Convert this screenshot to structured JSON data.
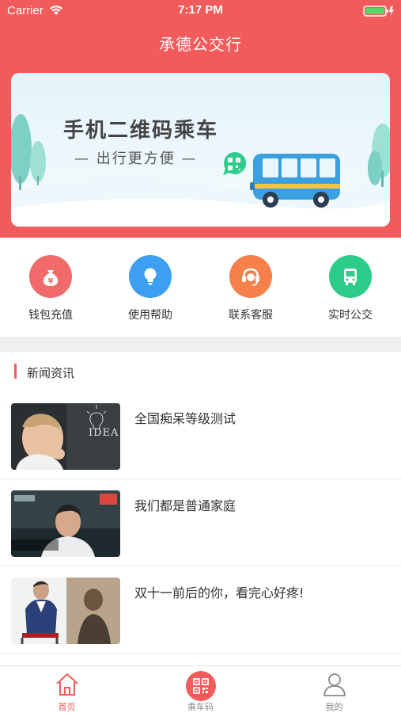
{
  "status_bar": {
    "carrier": "Carrier",
    "time": "7:17 PM"
  },
  "nav": {
    "title": "承德公交行"
  },
  "banner": {
    "title": "手机二维码乘车",
    "subtitle": "— 出行更方便 —"
  },
  "quick_menu": [
    {
      "label": "钱包充值",
      "icon": "money-bag-icon",
      "color": "#f06a6a"
    },
    {
      "label": "使用帮助",
      "icon": "lightbulb-icon",
      "color": "#3d9ff0"
    },
    {
      "label": "联系客服",
      "icon": "headset-icon",
      "color": "#f5804a"
    },
    {
      "label": "实时公交",
      "icon": "bus-icon",
      "color": "#2ecc8a"
    }
  ],
  "news": {
    "section_title": "新闻资讯",
    "items": [
      {
        "title": "全国痴呆等级测试",
        "thumb_text": "IDEA"
      },
      {
        "title": "我们都是普通家庭"
      },
      {
        "title": "双十一前后的你，看完心好疼!"
      }
    ]
  },
  "tabbar": [
    {
      "label": "首页",
      "icon": "home-icon",
      "active": true
    },
    {
      "label": "乘车码",
      "icon": "qr-code-icon",
      "active": false
    },
    {
      "label": "我的",
      "icon": "user-icon",
      "active": false
    }
  ],
  "colors": {
    "primary": "#f25b5b",
    "tab_inactive": "#888888"
  }
}
